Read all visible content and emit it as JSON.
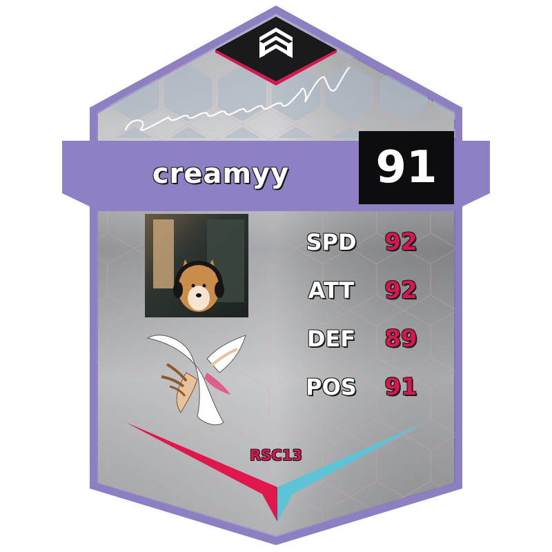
{
  "player": {
    "name": "creamyy",
    "signature": "creamyy",
    "rating": "91",
    "tag": "RSC13"
  },
  "stats": [
    {
      "label": "SPD",
      "value": "92"
    },
    {
      "label": "ATT",
      "value": "92"
    },
    {
      "label": "DEF",
      "value": "89"
    },
    {
      "label": "POS",
      "value": "91"
    }
  ],
  "icons": {
    "top": "layered-chevrons-logo-icon",
    "photo": "dog-with-headphones-photo",
    "emblem": "winged-angel-emblem-icon"
  },
  "colors": {
    "frame": "#8e7fc3",
    "banner": "#8f7fc5",
    "rating_bg": "#0d0d0f",
    "stat_value": "#d8164f",
    "accent_left": "#e0164c",
    "accent_right": "#5cc4d6"
  }
}
